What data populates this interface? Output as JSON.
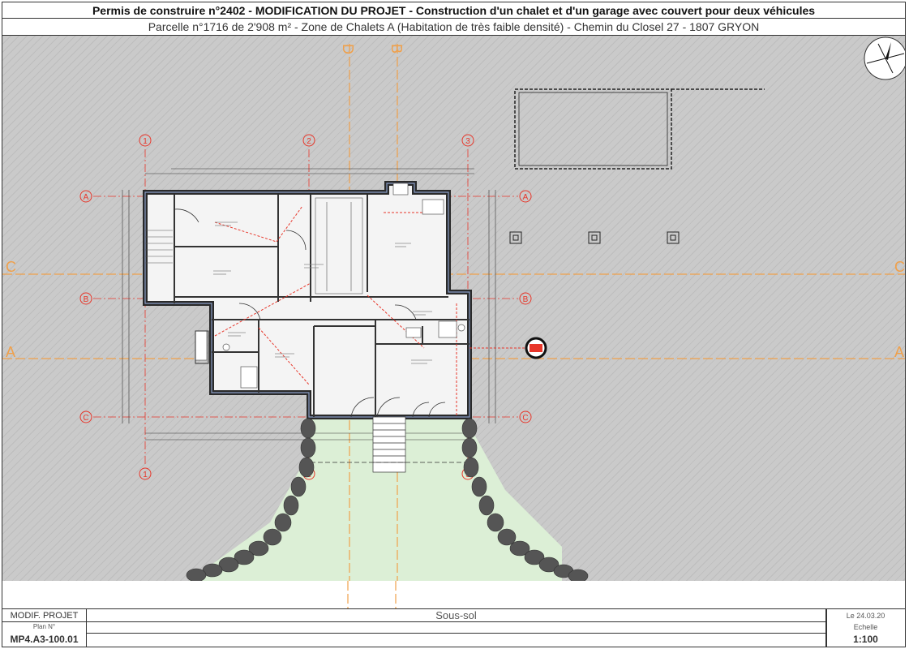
{
  "header": {
    "title": "Permis de construire n°2402 - MODIFICATION DU PROJET - Construction d'un chalet et d'un garage avec couvert pour deux véhicules",
    "subtitle": "Parcelle n°1716 de 2'908 m² - Zone de Chalets A (Habitation de très faible densité) - Chemin du Closel 27 - 1807 GRYON"
  },
  "axes": {
    "vertical": [
      "1",
      "2",
      "3"
    ],
    "horizontal": [
      "A",
      "B",
      "C"
    ],
    "sections": [
      "A",
      "B",
      "C",
      "D"
    ]
  },
  "title_block": {
    "modification_label": "MODIF. PROJET",
    "plan_label": "Plan N°",
    "plan_number": "MP4.A3-100.01",
    "floor_name": "Sous-sol",
    "date": "Le 24.03.20",
    "scale_label": "Echelle",
    "scale_value": "1:100"
  },
  "colors": {
    "axis_red": "#e8362a",
    "section_orange": "#f0a04a",
    "hatch_gray": "#c7c7c7",
    "garden_green": "#dcefd6",
    "wall_dark": "#2a2a2a",
    "stone": "#555555"
  },
  "icons": [
    "north-arrow-icon",
    "section-marker-icon"
  ]
}
